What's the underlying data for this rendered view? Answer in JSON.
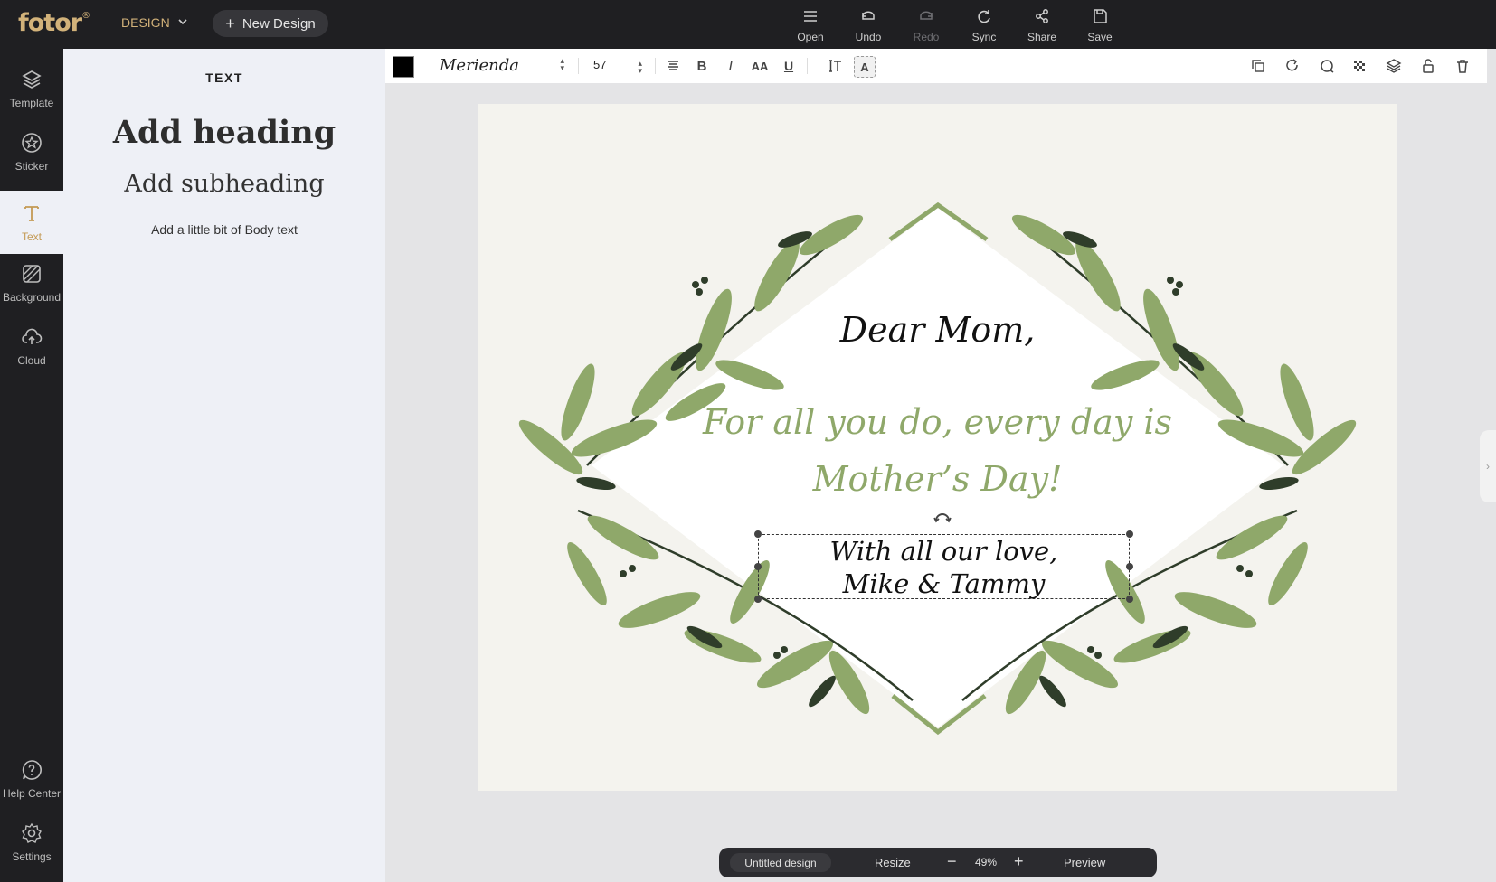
{
  "app": {
    "logo": "fotor",
    "logo_mark": "®"
  },
  "topbar": {
    "design_menu": "DESIGN",
    "new_design": "New Design",
    "buttons": [
      {
        "label": "Open",
        "icon": "menu-icon"
      },
      {
        "label": "Undo",
        "icon": "undo-icon"
      },
      {
        "label": "Redo",
        "icon": "redo-icon"
      },
      {
        "label": "Sync",
        "icon": "sync-icon"
      },
      {
        "label": "Share",
        "icon": "share-icon"
      },
      {
        "label": "Save",
        "icon": "save-icon"
      }
    ]
  },
  "sidebar": {
    "items": [
      {
        "label": "Template",
        "icon": "layers-icon"
      },
      {
        "label": "Sticker",
        "icon": "star-icon"
      },
      {
        "label": "Text",
        "icon": "text-icon"
      },
      {
        "label": "Background",
        "icon": "background-icon"
      },
      {
        "label": "Cloud",
        "icon": "cloud-upload-icon"
      },
      {
        "label": "Help Center",
        "icon": "help-icon"
      },
      {
        "label": "Settings",
        "icon": "gear-icon"
      }
    ],
    "active": "Text"
  },
  "panel": {
    "title": "TEXT",
    "heading": "Add heading",
    "subheading": "Add subheading",
    "body": "Add a little bit of Body text"
  },
  "text_toolbar": {
    "color": "#000000",
    "font": "Merienda",
    "size": "57"
  },
  "card": {
    "greeting": "Dear Mom,",
    "message_line1": "For all you do, every day is",
    "message_line2": "Mother’s Day!",
    "sign_line1": "With all our love,",
    "sign_line2": "Mike & Tammy",
    "colors": {
      "leaf_light": "#8fa86a",
      "leaf_dark": "#2f3d2a",
      "message": "#8fa86a",
      "background": "#f4f3ee"
    }
  },
  "bottombar": {
    "design_name": "Untitled design",
    "resize": "Resize",
    "zoom": "49%",
    "preview": "Preview"
  },
  "theme": {
    "accent": "#c49a54",
    "dark": "#1f1f22",
    "panel": "#eef0f6"
  }
}
